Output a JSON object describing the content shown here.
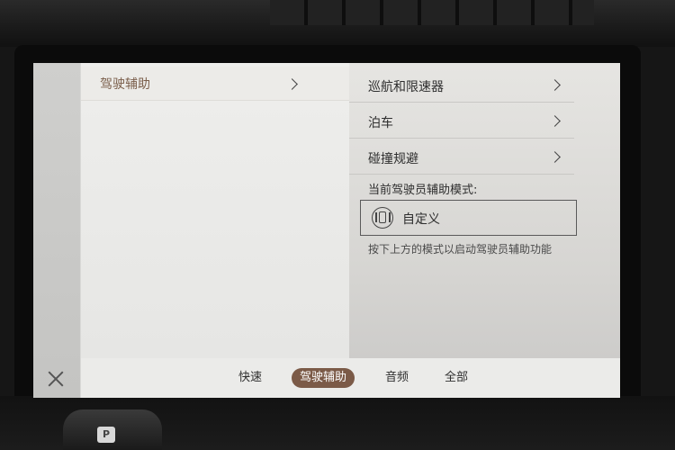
{
  "left_menu": {
    "item_label": "驾驶辅助"
  },
  "right_menu": {
    "items": [
      {
        "label": "巡航和限速器"
      },
      {
        "label": "泊车"
      },
      {
        "label": "碰撞规避"
      }
    ],
    "mode_section_label": "当前驾驶员辅助模式:",
    "mode_value": "自定义",
    "hint": "按下上方的模式以启动驾驶员辅助功能"
  },
  "tabs": [
    {
      "label": "快速",
      "active": false
    },
    {
      "label": "驾驶辅助",
      "active": true
    },
    {
      "label": "音频",
      "active": false
    },
    {
      "label": "全部",
      "active": false
    }
  ],
  "shifter_label": "P",
  "icons": {
    "close": "close-icon",
    "chevron": "chevron-right-icon",
    "mode": "driver-assist-mode-icon"
  },
  "colors": {
    "accent": "#7b5a47",
    "left_label": "#7a5e4a"
  }
}
